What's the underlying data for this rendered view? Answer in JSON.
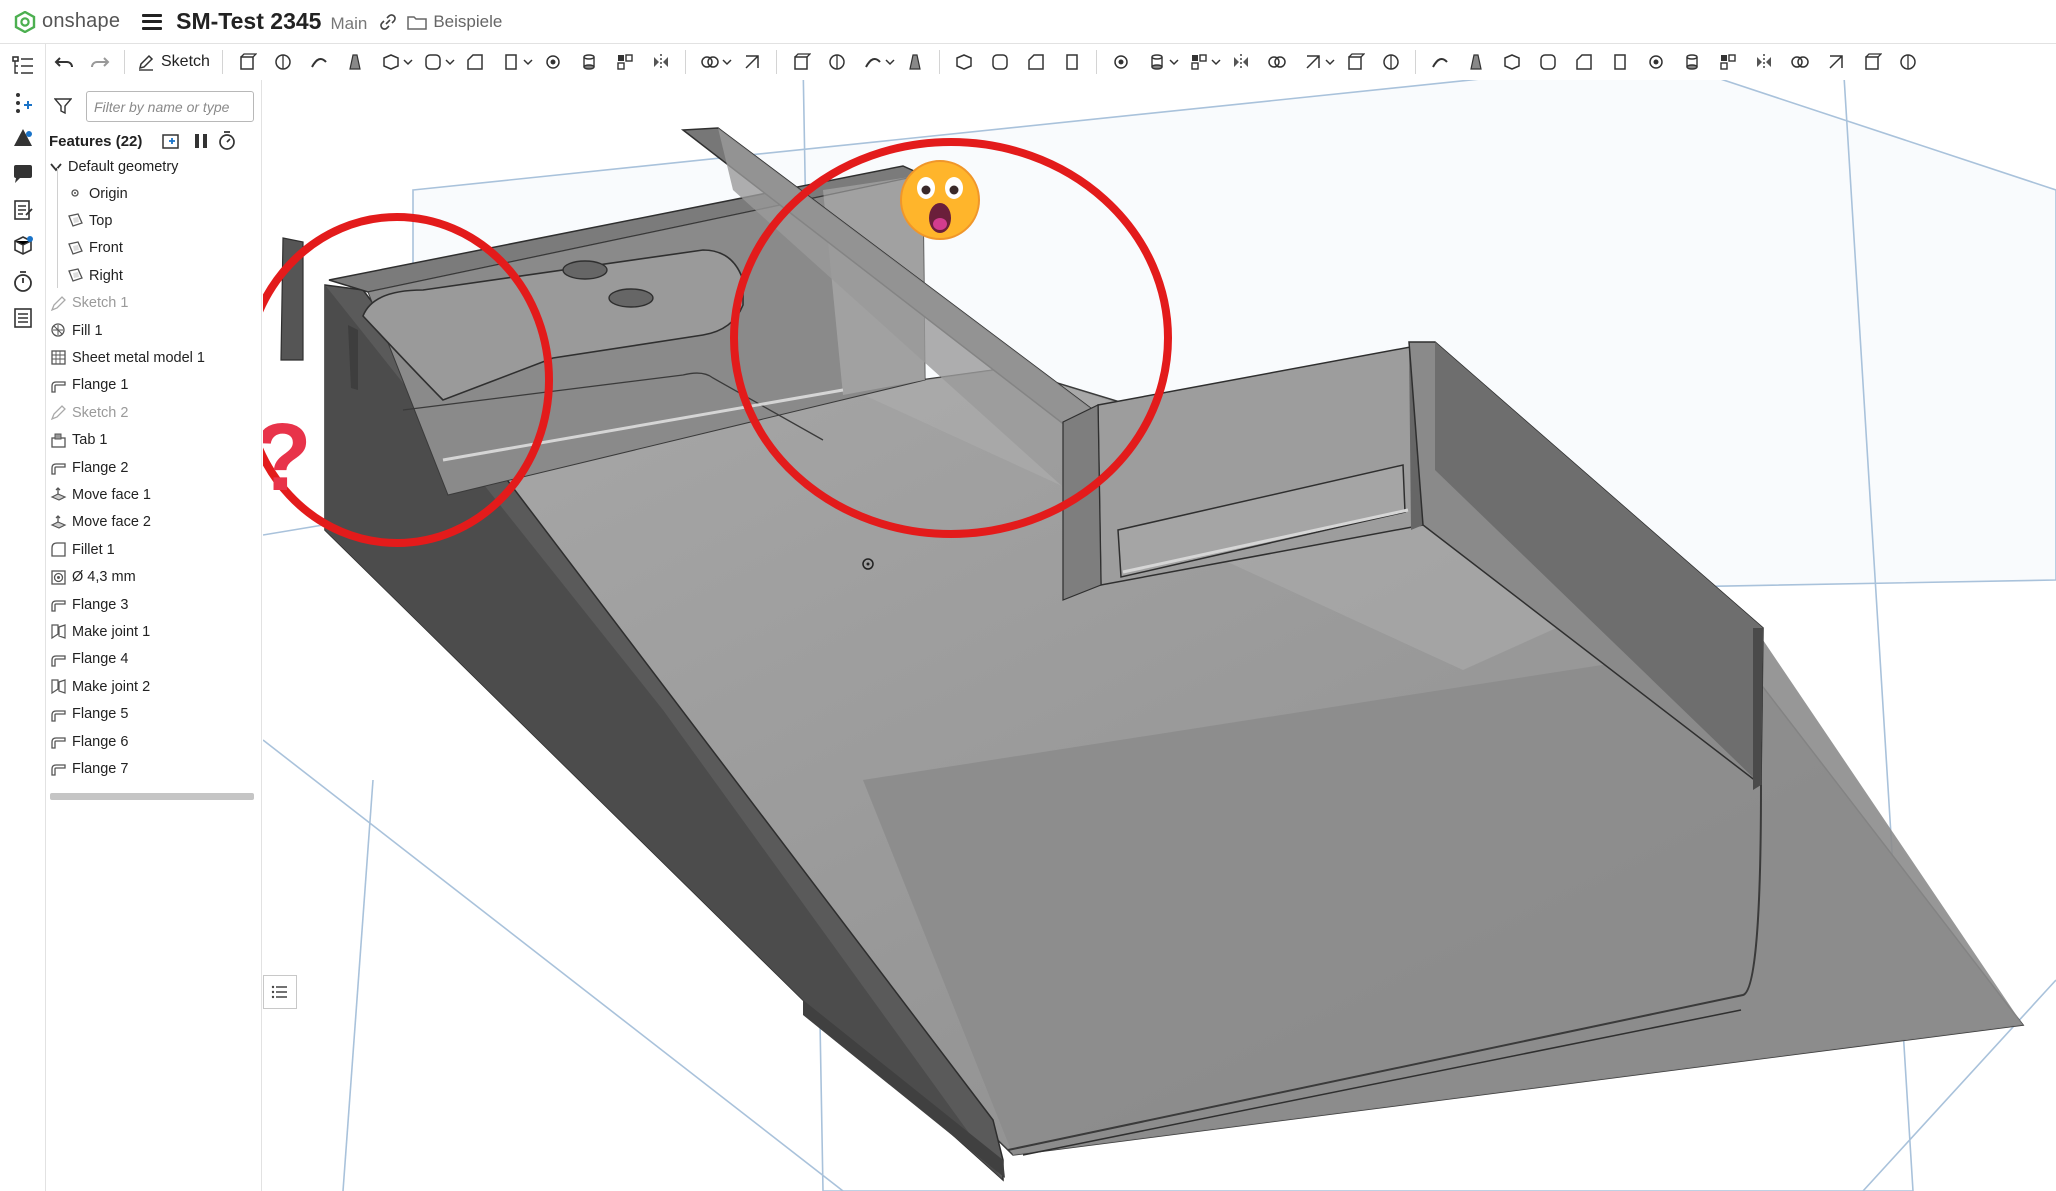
{
  "app": {
    "name": "onshape"
  },
  "document": {
    "title": "SM-Test 2345",
    "branch": "Main",
    "folder": "Beispiele"
  },
  "toolbar": {
    "sketch_label": "Sketch"
  },
  "feature_panel": {
    "filter_placeholder": "Filter by name or type",
    "header": "Features (22)",
    "default_geometry": "Default geometry",
    "items": [
      {
        "label": "Origin",
        "icon": "origin-icon",
        "level": 2,
        "dim": false
      },
      {
        "label": "Top",
        "icon": "plane-icon",
        "level": 2,
        "dim": false
      },
      {
        "label": "Front",
        "icon": "plane-icon",
        "level": 2,
        "dim": false
      },
      {
        "label": "Right",
        "icon": "plane-icon",
        "level": 2,
        "dim": false
      },
      {
        "label": "Sketch 1",
        "icon": "sketch-icon",
        "level": 1,
        "dim": true
      },
      {
        "label": "Fill 1",
        "icon": "fill-icon",
        "level": 1,
        "dim": false
      },
      {
        "label": "Sheet metal model 1",
        "icon": "sheet-metal-icon",
        "level": 1,
        "dim": false
      },
      {
        "label": "Flange 1",
        "icon": "flange-icon",
        "level": 1,
        "dim": false
      },
      {
        "label": "Sketch 2",
        "icon": "sketch-icon",
        "level": 1,
        "dim": true
      },
      {
        "label": "Tab 1",
        "icon": "tab-icon",
        "level": 1,
        "dim": false
      },
      {
        "label": "Flange 2",
        "icon": "flange-icon",
        "level": 1,
        "dim": false
      },
      {
        "label": "Move face 1",
        "icon": "move-face-icon",
        "level": 1,
        "dim": false
      },
      {
        "label": "Move face 2",
        "icon": "move-face-icon",
        "level": 1,
        "dim": false
      },
      {
        "label": "Fillet 1",
        "icon": "fillet-icon",
        "level": 1,
        "dim": false
      },
      {
        "label": "Ø 4,3 mm",
        "icon": "hole-icon",
        "level": 1,
        "dim": false
      },
      {
        "label": "Flange 3",
        "icon": "flange-icon",
        "level": 1,
        "dim": false
      },
      {
        "label": "Make joint 1",
        "icon": "make-joint-icon",
        "level": 1,
        "dim": false
      },
      {
        "label": "Flange 4",
        "icon": "flange-icon",
        "level": 1,
        "dim": false
      },
      {
        "label": "Make joint 2",
        "icon": "make-joint-icon",
        "level": 1,
        "dim": false
      },
      {
        "label": "Flange 5",
        "icon": "flange-icon",
        "level": 1,
        "dim": false
      },
      {
        "label": "Flange 6",
        "icon": "flange-icon",
        "level": 1,
        "dim": false
      },
      {
        "label": "Flange 7",
        "icon": "flange-icon",
        "level": 1,
        "dim": false
      }
    ]
  },
  "annotations": {
    "question_mark": "?",
    "emoji": "😱"
  },
  "colors": {
    "brand_green": "#4caf50",
    "annotation_red": "#e31b1b",
    "plane_blue": "#a9c2db",
    "part_grey": "#8e8e8e"
  }
}
